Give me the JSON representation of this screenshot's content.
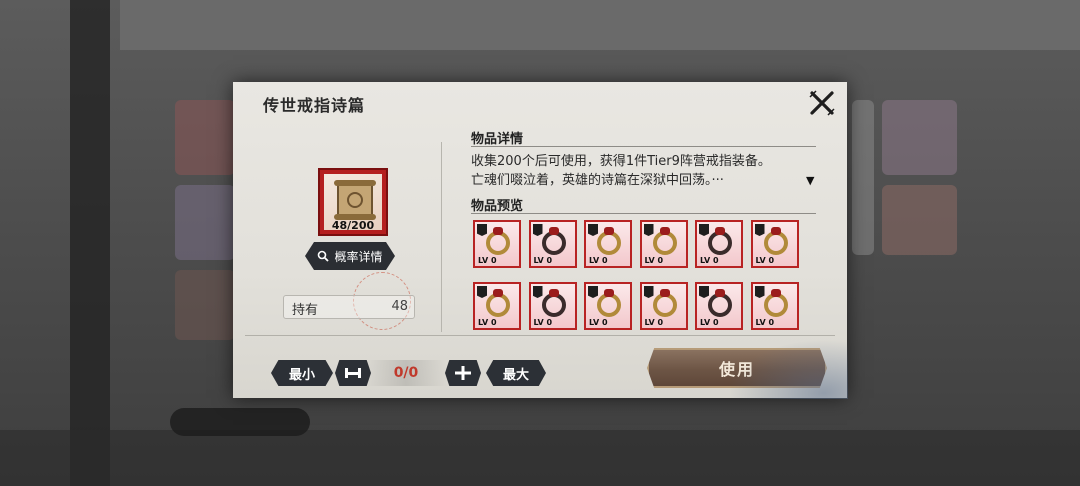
{
  "dialog": {
    "title": "传世戒指诗篇",
    "close_label": "关闭"
  },
  "item": {
    "count": "48/200",
    "prob_button": "概率详情",
    "hold_label": "持有",
    "hold_value": "48"
  },
  "details": {
    "heading": "物品详情",
    "line1": "收集200个后可使用，获得1件Tier9阵营戒指装备。",
    "line2": "亡魂们啜泣着，英雄的诗篇在深狱中回荡。···",
    "expand_icon": "chevron-down-icon"
  },
  "preview": {
    "heading": "物品预览",
    "items": [
      {
        "lv": "LV 0",
        "style": "gold"
      },
      {
        "lv": "LV 0",
        "style": "dark"
      },
      {
        "lv": "LV 0",
        "style": "gold"
      },
      {
        "lv": "LV 0",
        "style": "gold"
      },
      {
        "lv": "LV 0",
        "style": "dark"
      },
      {
        "lv": "LV 0",
        "style": "gold"
      },
      {
        "lv": "LV 0",
        "style": "gold"
      },
      {
        "lv": "LV 0",
        "style": "dark"
      },
      {
        "lv": "LV 0",
        "style": "gold"
      },
      {
        "lv": "LV 0",
        "style": "gold"
      },
      {
        "lv": "LV 0",
        "style": "dark"
      },
      {
        "lv": "LV 0",
        "style": "gold"
      }
    ]
  },
  "controls": {
    "min_label": "最小",
    "minus_icon": "minus-icon",
    "quantity": "0/0",
    "plus_icon": "plus-icon",
    "max_label": "最大",
    "use_label": "使用"
  },
  "colors": {
    "accent_red": "#b82323",
    "qty_red": "#c0392b",
    "button_dark": "#2c3036"
  }
}
